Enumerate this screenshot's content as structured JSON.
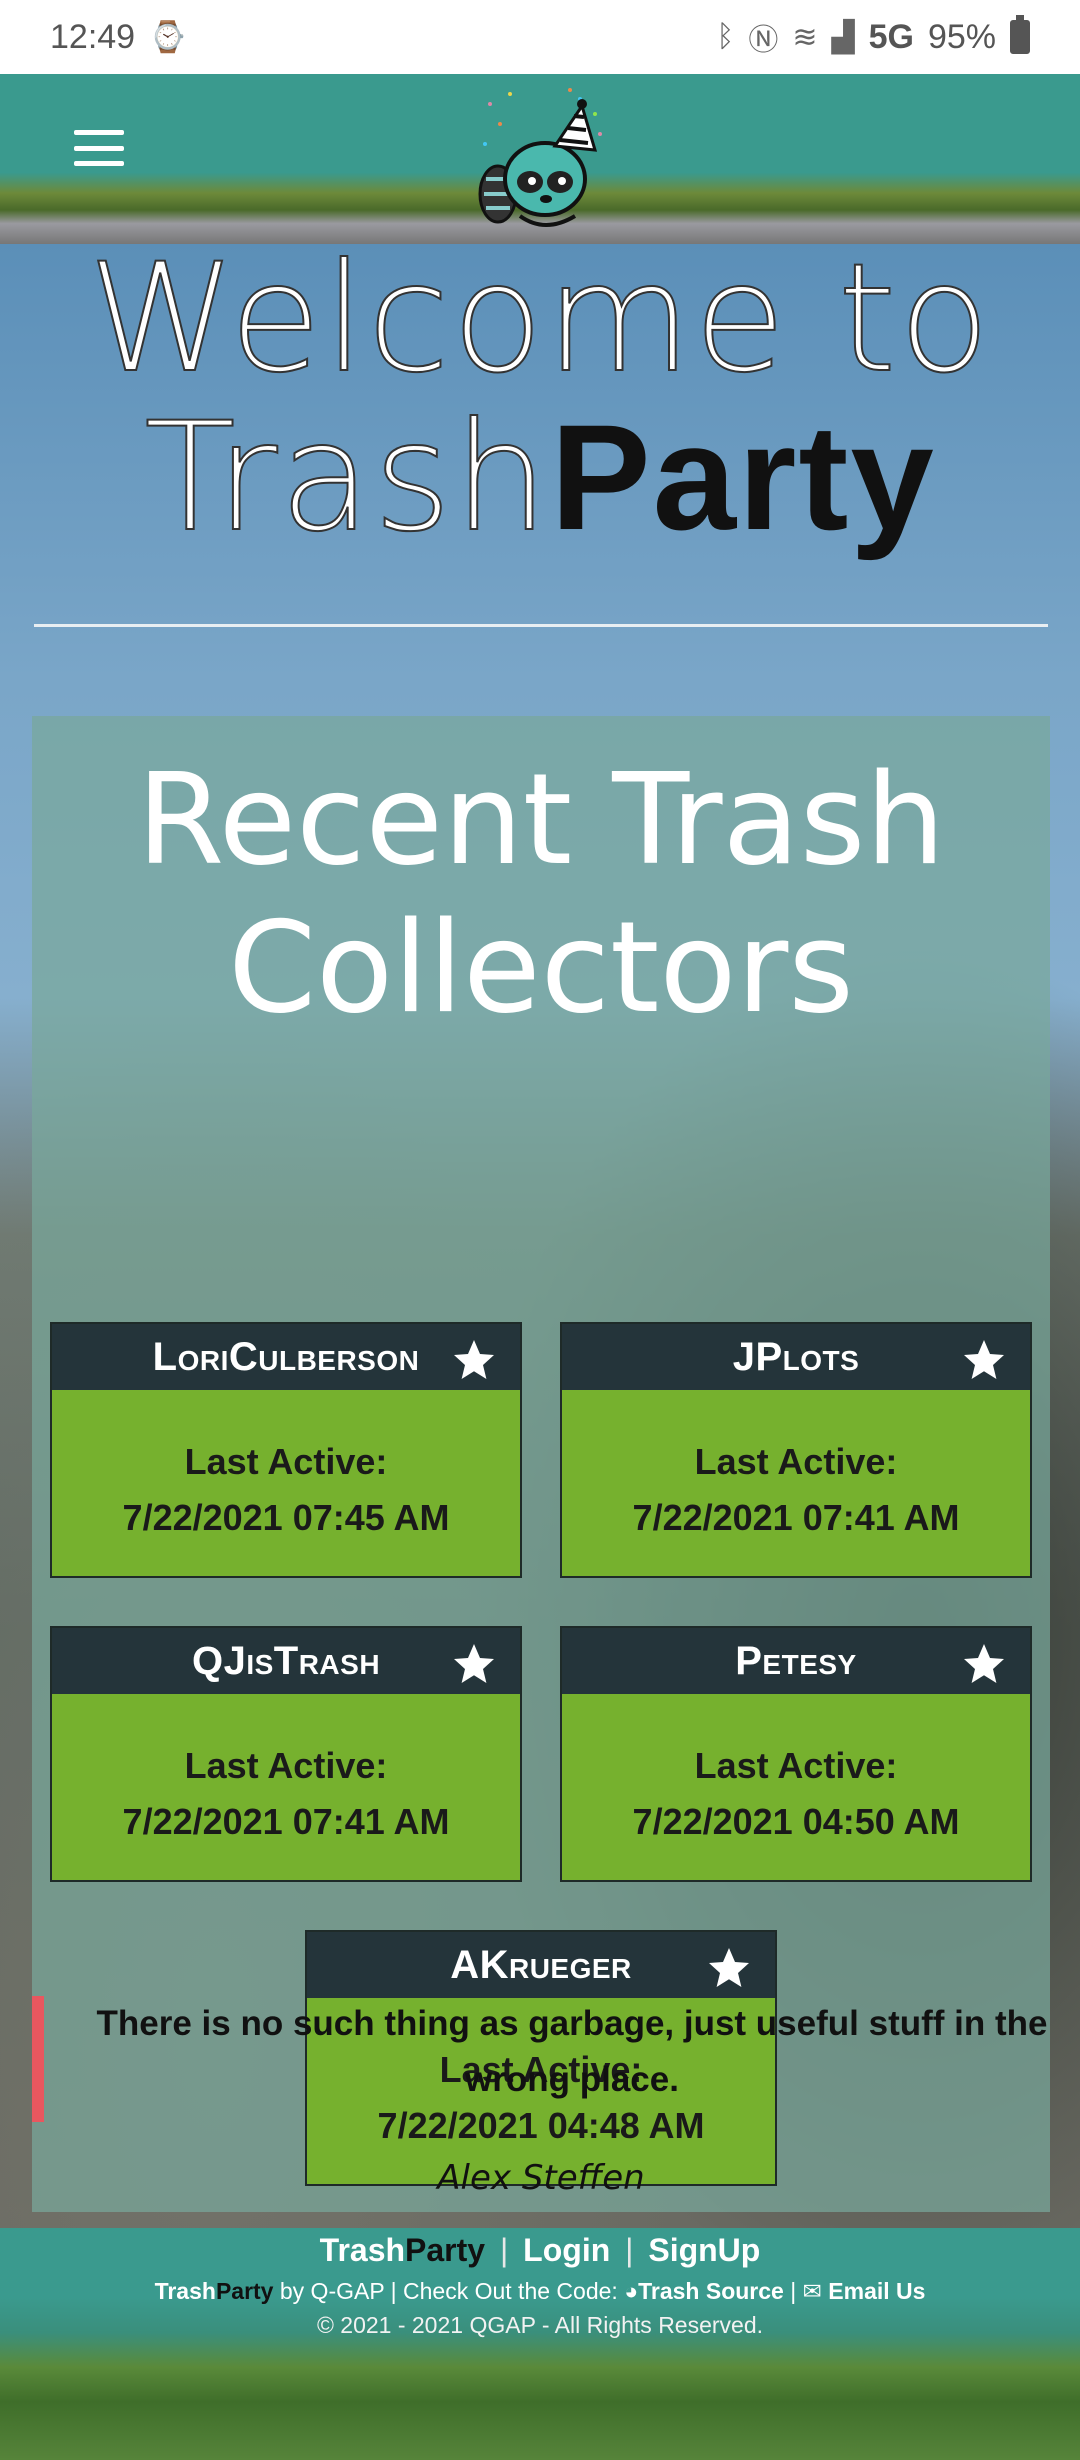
{
  "status_bar": {
    "time": "12:49",
    "network": "5G",
    "battery": "95%"
  },
  "header": {
    "menu_icon": "hamburger-icon",
    "logo_icon": "raccoon-party-hat-logo"
  },
  "hero": {
    "welcome_line1": "Welcome to",
    "welcome_trash": "Trash",
    "welcome_party": "Party"
  },
  "recent": {
    "title_line1": "Recent Trash",
    "title_line2": "Collectors",
    "last_active_label": "Last Active:",
    "collectors": [
      {
        "name": "LoriCulberson",
        "last_active": "7/22/2021 07:45 AM"
      },
      {
        "name": "JPlots",
        "last_active": "7/22/2021 07:41 AM"
      },
      {
        "name": "QJisTrash",
        "last_active": "7/22/2021 07:41 AM"
      },
      {
        "name": "Petesy",
        "last_active": "7/22/2021 04:50 AM"
      },
      {
        "name": "AKrueger",
        "last_active": "7/22/2021 04:48 AM"
      }
    ]
  },
  "quote": {
    "text": "There is no such thing as garbage, just useful stuff in the wrong place.",
    "author": "Alex Steffen"
  },
  "footer": {
    "brand_trash": "Trash",
    "brand_party": "Party",
    "login": "Login",
    "signup": "SignUp",
    "separator": "|",
    "by_text": "by Q-GAP | Check Out the Code:",
    "source_link": "Trash Source",
    "email_link": "Email Us",
    "copyright": "© 2021 - 2021 QGAP - All Rights Reserved."
  },
  "colors": {
    "header_teal": "#3a9a8e",
    "card_head": "#24343a",
    "card_body": "#76b12e",
    "quote_bar": "#e8575f"
  }
}
